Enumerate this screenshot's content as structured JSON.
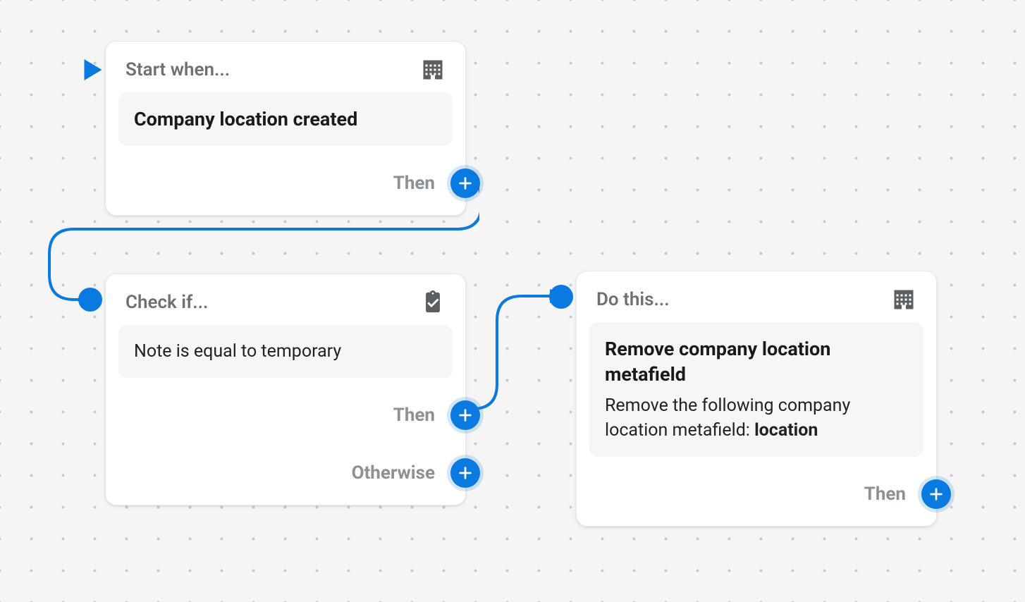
{
  "trigger": {
    "header": "Start when...",
    "body_title": "Company location created",
    "then_label": "Then"
  },
  "condition": {
    "header": "Check if...",
    "body_text": "Note is equal to temporary",
    "then_label": "Then",
    "otherwise_label": "Otherwise"
  },
  "action": {
    "header": "Do this...",
    "body_title": "Remove company location metafield",
    "body_desc_prefix": "Remove the following company location metafield: ",
    "body_desc_bold": "location",
    "then_label": "Then"
  }
}
